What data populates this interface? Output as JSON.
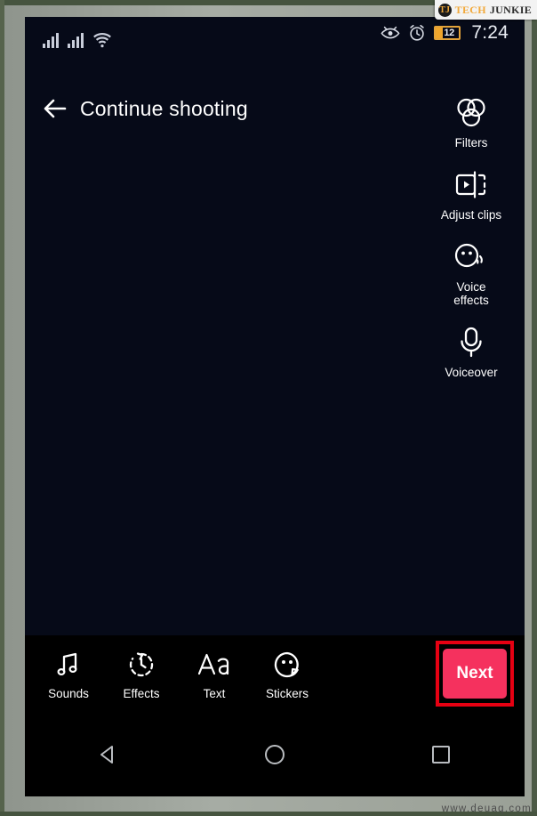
{
  "watermark_brand": {
    "logo_letters": "TJ",
    "tech": "TECH",
    "junkie": "JUNKIE"
  },
  "bottom_watermark": "www.deuaq.com",
  "status_bar": {
    "time": "7:24",
    "battery_percent": "12",
    "icons": [
      "signal-bars-icon",
      "signal-bars-icon",
      "wifi-icon",
      "eye-comfort-icon",
      "alarm-clock-icon",
      "battery-icon"
    ]
  },
  "header": {
    "back_icon": "back-arrow-icon",
    "title": "Continue shooting"
  },
  "right_rail": {
    "items": [
      {
        "label": "Filters",
        "icon": "filters-circles-icon"
      },
      {
        "label": "Adjust clips",
        "icon": "adjust-clips-icon"
      },
      {
        "label": "Voice effects",
        "label_line1": "Voice",
        "label_line2": "effects",
        "icon": "voice-effects-icon"
      },
      {
        "label": "Voiceover",
        "icon": "microphone-icon"
      }
    ]
  },
  "bottom_toolbar": {
    "items": [
      {
        "label": "Sounds",
        "icon": "music-note-icon"
      },
      {
        "label": "Effects",
        "icon": "clock-effects-icon"
      },
      {
        "label": "Text",
        "icon": "text-aa-icon"
      },
      {
        "label": "Stickers",
        "icon": "sticker-smiley-icon"
      }
    ],
    "next_label": "Next",
    "next_color": "#f5315e",
    "highlight_color": "#e60012"
  },
  "nav_bar": {
    "items": [
      {
        "name": "back",
        "icon": "nav-back-triangle-icon"
      },
      {
        "name": "home",
        "icon": "nav-home-circle-icon"
      },
      {
        "name": "recents",
        "icon": "nav-recents-square-icon"
      }
    ]
  }
}
